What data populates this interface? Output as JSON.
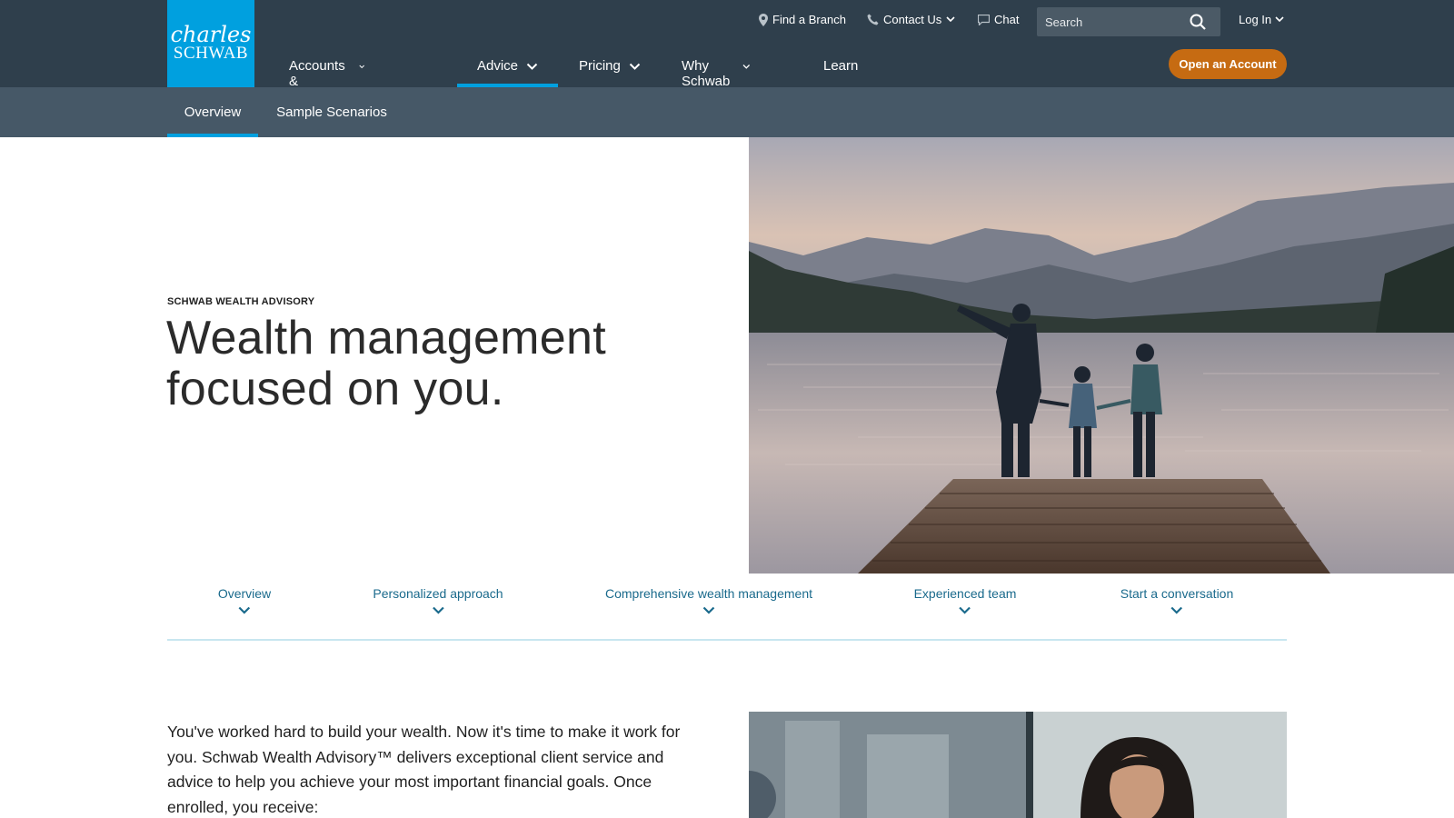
{
  "brand": {
    "logo_line1": "charles",
    "logo_line2": "SCHWAB",
    "logo_color": "#00a0df"
  },
  "header": {
    "utility": {
      "find_branch": "Find a Branch",
      "contact_us": "Contact Us",
      "chat": "Chat",
      "search_placeholder": "Search",
      "login": "Log In"
    },
    "nav": [
      {
        "label": "Accounts & Products",
        "icon": "chevron-down-icon"
      },
      {
        "label": "Advice",
        "icon": "chevron-down-icon",
        "active": true
      },
      {
        "label": "Pricing",
        "icon": "chevron-down-icon"
      },
      {
        "label": "Why Schwab",
        "icon": "chevron-down-icon"
      },
      {
        "label": "Learn"
      }
    ],
    "open_account": "Open an Account",
    "colors": {
      "header_bg": "#2f3f4c",
      "subnav_bg": "#465867",
      "accent": "#00a0df",
      "cta": "#c66b12"
    }
  },
  "subnav": {
    "items": [
      "Overview",
      "Sample Scenarios"
    ],
    "active": "Overview"
  },
  "hero": {
    "eyebrow": "SCHWAB WEALTH ADVISORY",
    "title_line1": "Wealth management",
    "title_line2": "focused on you."
  },
  "anchors": [
    {
      "label": "Overview"
    },
    {
      "label": "Personalized approach"
    },
    {
      "label": "Comprehensive wealth management"
    },
    {
      "label": "Experienced team"
    },
    {
      "label": "Start a conversation"
    }
  ],
  "intro": {
    "text": "You've worked hard to build your wealth. Now it's time to make it work for you. Schwab Wealth Advisory™ delivers exceptional client service and advice to help you achieve your most important financial goals. Once enrolled, you receive:"
  }
}
